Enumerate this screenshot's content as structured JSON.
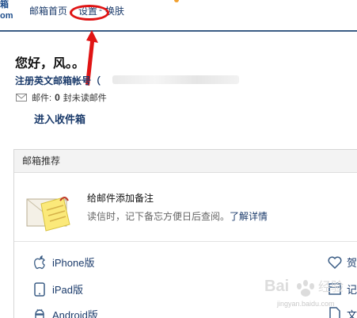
{
  "logo": {
    "line1": "箱",
    "line2": "om"
  },
  "nav": {
    "home": "邮箱首页",
    "settings": "设置",
    "sep": "-",
    "skin": "换肤"
  },
  "greeting": "您好，风。。",
  "register": {
    "label": "注册英文邮箱帐号（"
  },
  "mail": {
    "label": "邮件:",
    "count": "0",
    "suffix": "封未读邮件"
  },
  "inbox_link": "进入收件箱",
  "panel": {
    "title": "邮箱推荐",
    "tip_title": "给邮件添加备注",
    "tip_desc": "读信时，记下备忘方便日后查阅。",
    "tip_link": "了解详情"
  },
  "apps": [
    {
      "label": "iPhone版",
      "icon": "apple-icon"
    },
    {
      "label": "iPad版",
      "icon": "tablet-icon"
    },
    {
      "label": "Android版",
      "icon": "android-icon"
    }
  ],
  "right_items": [
    {
      "label": "贺",
      "icon": "heart-icon"
    },
    {
      "label": "记",
      "icon": "calendar-icon"
    },
    {
      "label": "文",
      "icon": "document-icon"
    }
  ],
  "watermark": "jingyan.baidu.com",
  "colors": {
    "nav_text": "#1b3b6b",
    "annotation": "#e01414",
    "topbar_border": "#3b5d85"
  }
}
